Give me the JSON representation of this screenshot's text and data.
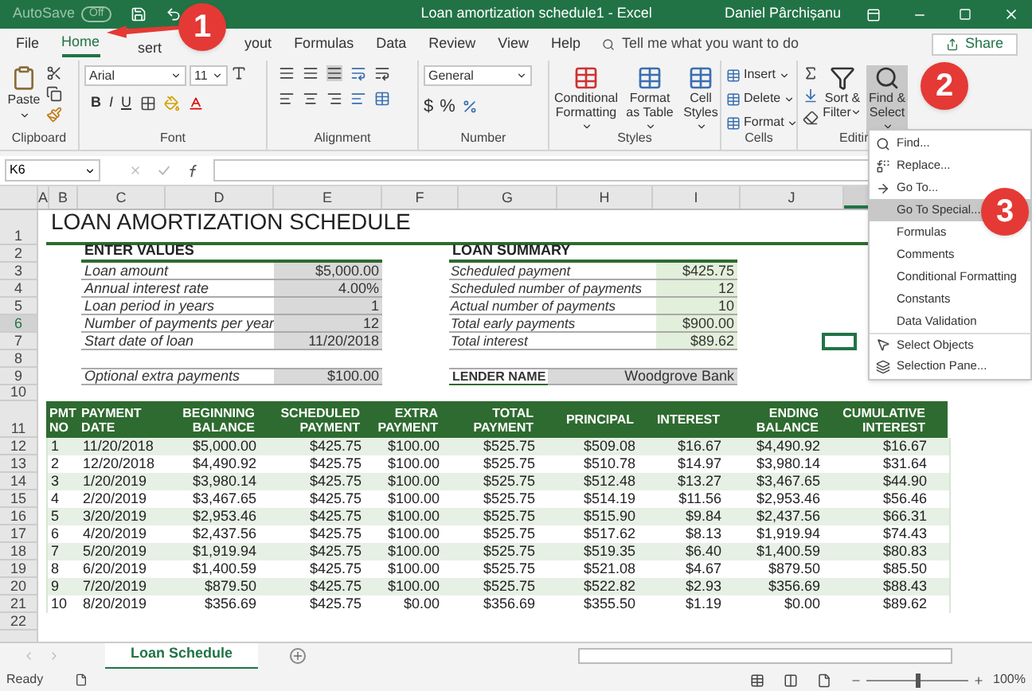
{
  "title_bar": {
    "autosave": "AutoSave",
    "autosave_on": false,
    "autosave_state": "Off",
    "title": "Loan amortization schedule1  -  Excel",
    "user": "Daniel Pârchișanu"
  },
  "menu_tabs": [
    {
      "label": "File",
      "selected": false
    },
    {
      "label": "Home",
      "selected": true
    },
    {
      "label": "sert",
      "selected": false
    },
    {
      "label": "yout",
      "selected": false
    },
    {
      "label": "Formulas",
      "selected": false
    },
    {
      "label": "Data",
      "selected": false
    },
    {
      "label": "Review",
      "selected": false
    },
    {
      "label": "View",
      "selected": false
    },
    {
      "label": "Help",
      "selected": false
    }
  ],
  "tell_me": {
    "placeholder": "Tell me what you want to do"
  },
  "share": "Share",
  "ribbon": {
    "clipboard": {
      "paste": "Paste",
      "label": "Clipboard"
    },
    "font": {
      "name": "Arial",
      "size": "11",
      "bold": "B",
      "italic": "I",
      "underline": "U",
      "label": "Font"
    },
    "alignment": {
      "label": "Alignment"
    },
    "number": {
      "format": "General",
      "currency": "$",
      "percent": "%",
      "label": "Number"
    },
    "styles": {
      "label": "Styles",
      "buttons": [
        "Conditional Formatting",
        "Format as Table",
        "Cell Styles"
      ]
    },
    "cells": {
      "label": "Cells",
      "buttons": [
        "Insert",
        "Delete",
        "Format"
      ]
    },
    "editing": {
      "label": "Editin",
      "buttons": [
        {
          "label": "Sort & Filter",
          "selected": false
        },
        {
          "label": "Find & Select",
          "selected": true
        }
      ]
    }
  },
  "name_box": "K6",
  "columns": [
    "A",
    "B",
    "C",
    "D",
    "E",
    "F",
    "G",
    "H",
    "I",
    "J"
  ],
  "row_numbers": [
    "1",
    "2",
    "3",
    "4",
    "5",
    "6",
    "7",
    "8",
    "9",
    "10",
    "11",
    "12",
    "13",
    "14",
    "15",
    "16",
    "17",
    "18",
    "19",
    "20",
    "21",
    "22"
  ],
  "sheet": {
    "title": "LOAN AMORTIZATION SCHEDULE",
    "enter_values": {
      "heading": "ENTER VALUES",
      "items": [
        {
          "label": "Loan amount",
          "value": "$5,000.00"
        },
        {
          "label": "Annual interest rate",
          "value": "4.00%"
        },
        {
          "label": "Loan period in years",
          "value": "1"
        },
        {
          "label": "Number of payments per year",
          "value": "12"
        },
        {
          "label": "Start date of loan",
          "value": "11/20/2018"
        }
      ]
    },
    "loan_summary": {
      "heading": "LOAN SUMMARY",
      "items": [
        {
          "label": "Scheduled payment",
          "value": "$425.75"
        },
        {
          "label": "Scheduled number of payments",
          "value": "12"
        },
        {
          "label": "Actual number of payments",
          "value": "10"
        },
        {
          "label": "Total early payments",
          "value": "$900.00"
        },
        {
          "label": "Total interest",
          "value": "$89.62"
        }
      ]
    },
    "extra": {
      "label": "Optional extra payments",
      "value": "$100.00"
    },
    "lender": {
      "label": "LENDER NAME",
      "value": "Woodgrove Bank"
    },
    "table": {
      "columns": [
        "PMT NO",
        "PAYMENT DATE",
        "BEGINNING BALANCE",
        "SCHEDULED PAYMENT",
        "EXTRA PAYMENT",
        "TOTAL PAYMENT",
        "PRINCIPAL",
        "INTEREST",
        "ENDING BALANCE",
        "CUMULATIVE INTEREST"
      ],
      "rows": [
        [
          "1",
          "11/20/2018",
          "$5,000.00",
          "$425.75",
          "$100.00",
          "$525.75",
          "$509.08",
          "$16.67",
          "$4,490.92",
          "$16.67"
        ],
        [
          "2",
          "12/20/2018",
          "$4,490.92",
          "$425.75",
          "$100.00",
          "$525.75",
          "$510.78",
          "$14.97",
          "$3,980.14",
          "$31.64"
        ],
        [
          "3",
          "1/20/2019",
          "$3,980.14",
          "$425.75",
          "$100.00",
          "$525.75",
          "$512.48",
          "$13.27",
          "$3,467.65",
          "$44.90"
        ],
        [
          "4",
          "2/20/2019",
          "$3,467.65",
          "$425.75",
          "$100.00",
          "$525.75",
          "$514.19",
          "$11.56",
          "$2,953.46",
          "$56.46"
        ],
        [
          "5",
          "3/20/2019",
          "$2,953.46",
          "$425.75",
          "$100.00",
          "$525.75",
          "$515.90",
          "$9.84",
          "$2,437.56",
          "$66.31"
        ],
        [
          "6",
          "4/20/2019",
          "$2,437.56",
          "$425.75",
          "$100.00",
          "$525.75",
          "$517.62",
          "$8.13",
          "$1,919.94",
          "$74.43"
        ],
        [
          "7",
          "5/20/2019",
          "$1,919.94",
          "$425.75",
          "$100.00",
          "$525.75",
          "$519.35",
          "$6.40",
          "$1,400.59",
          "$80.83"
        ],
        [
          "8",
          "6/20/2019",
          "$1,400.59",
          "$425.75",
          "$100.00",
          "$525.75",
          "$521.08",
          "$4.67",
          "$879.50",
          "$85.50"
        ],
        [
          "9",
          "7/20/2019",
          "$879.50",
          "$425.75",
          "$100.00",
          "$525.75",
          "$522.82",
          "$2.93",
          "$356.69",
          "$88.43"
        ],
        [
          "10",
          "8/20/2019",
          "$356.69",
          "$425.75",
          "$0.00",
          "$356.69",
          "$355.50",
          "$1.19",
          "$0.00",
          "$89.62"
        ]
      ]
    }
  },
  "find_menu": [
    {
      "label": "Find...",
      "kind": "find",
      "selected": false
    },
    {
      "label": "Replace...",
      "kind": "replace",
      "selected": false
    },
    {
      "label": "Go To...",
      "kind": "goto",
      "selected": false
    },
    {
      "label": "Go To Special...",
      "kind": "plain",
      "selected": true
    },
    {
      "label": "Formulas",
      "kind": "plain",
      "selected": false
    },
    {
      "label": "Comments",
      "kind": "plain",
      "selected": false
    },
    {
      "label": "Conditional Formatting",
      "kind": "plain",
      "selected": false
    },
    {
      "label": "Constants",
      "kind": "plain",
      "selected": false
    },
    {
      "label": "Data Validation",
      "kind": "plain",
      "selected": false
    },
    {
      "label": "Select Objects",
      "kind": "pointer",
      "selected": false
    },
    {
      "label": "Selection Pane...",
      "kind": "pane",
      "selected": false
    }
  ],
  "sheet_tabs": [
    {
      "label": "Loan Schedule",
      "selected": true
    }
  ],
  "status_bar": {
    "status": "Ready",
    "zoom": {
      "level": 0.5
    },
    "zoom_label": "100%"
  },
  "annotations": [
    "1",
    "2",
    "3"
  ]
}
